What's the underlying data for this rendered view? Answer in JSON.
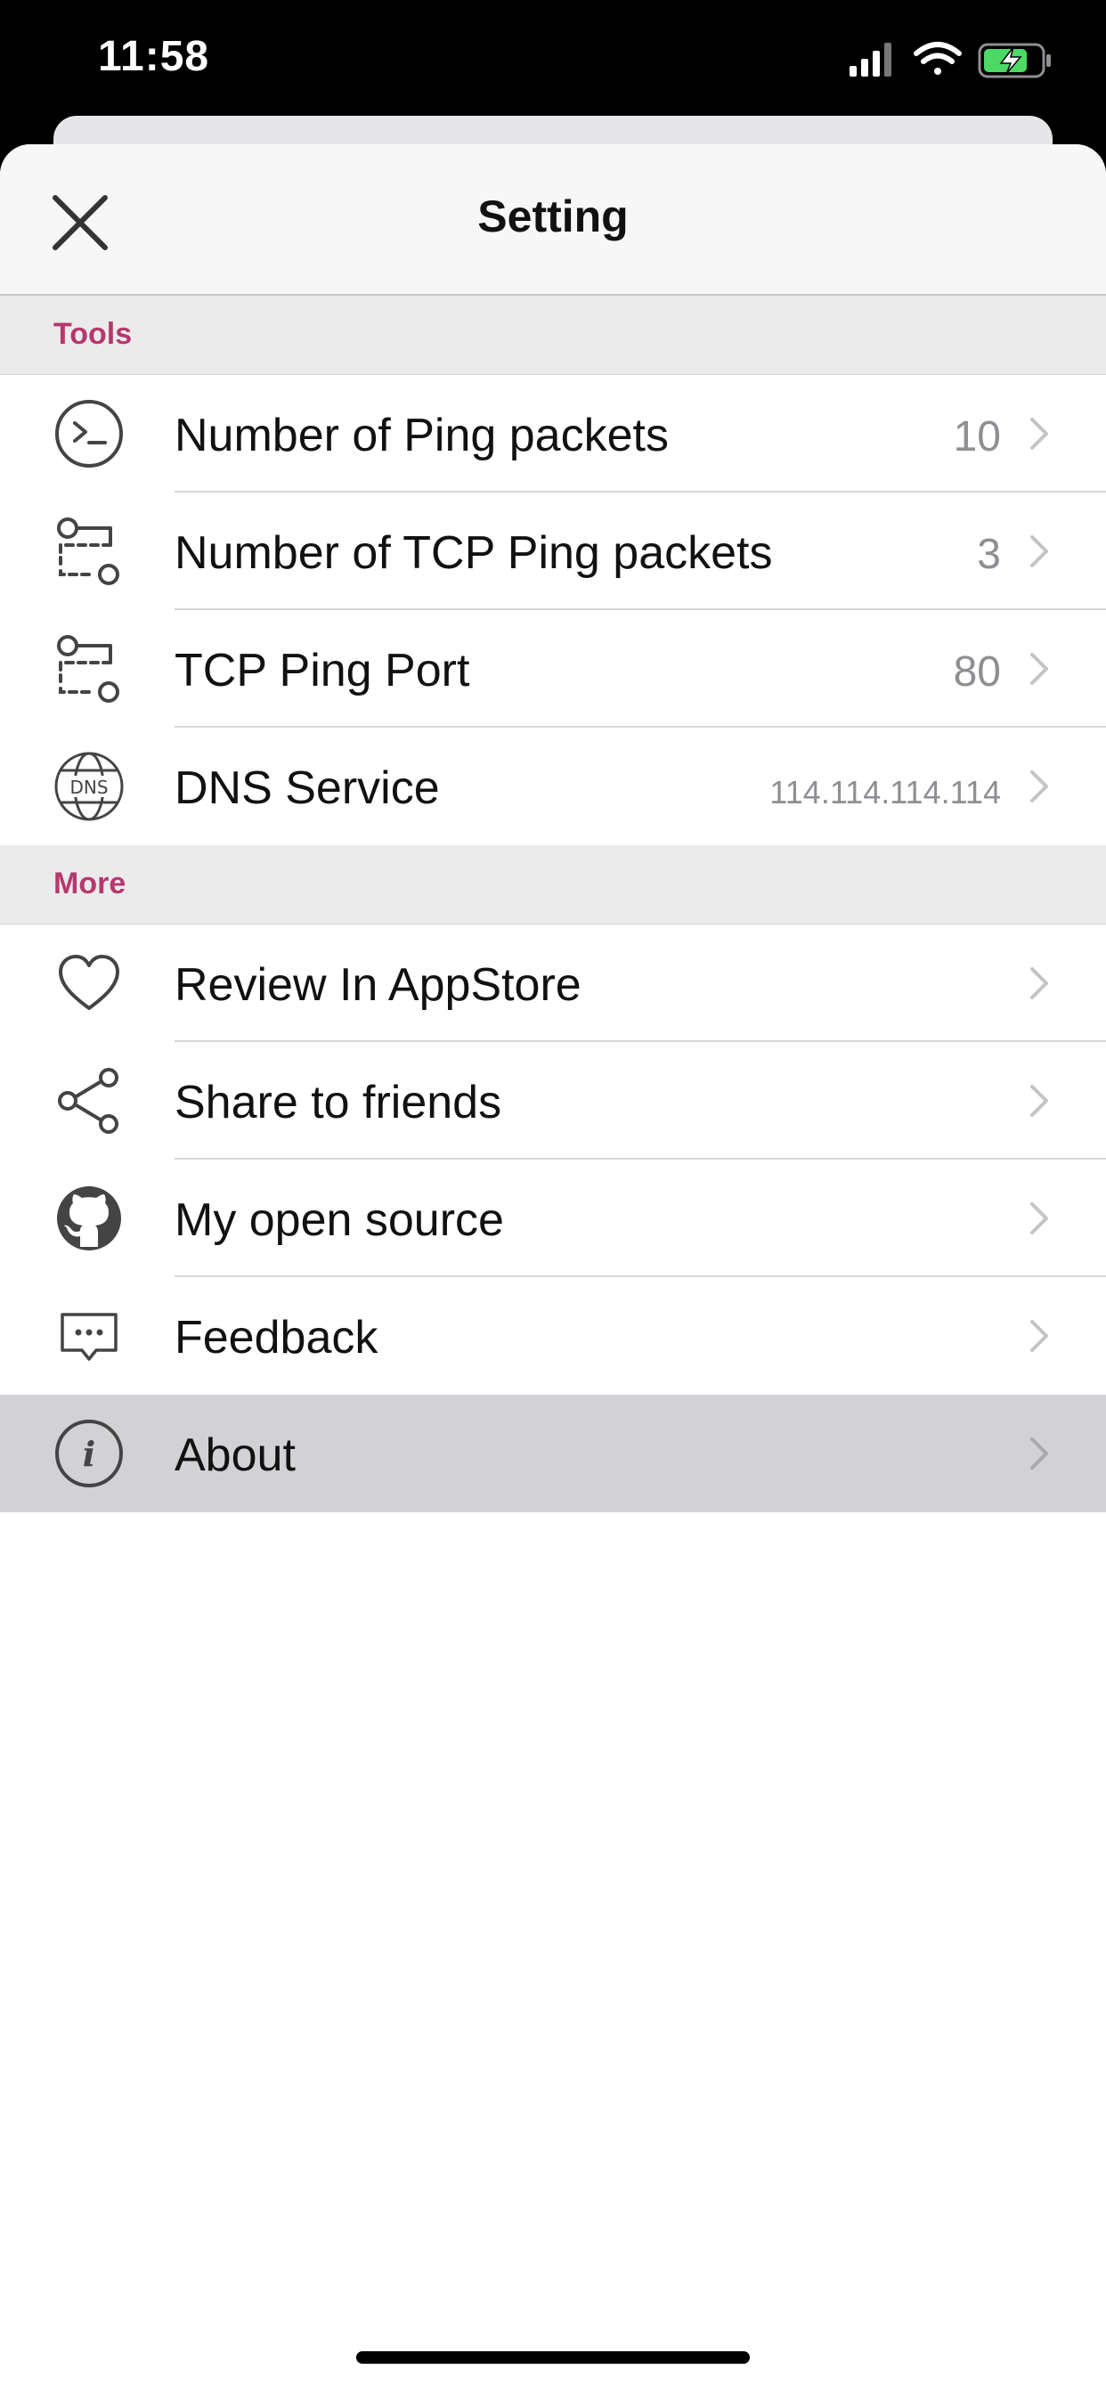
{
  "status_bar": {
    "time": "11:58"
  },
  "nav": {
    "title": "Setting"
  },
  "sections": [
    {
      "title": "Tools",
      "rows": [
        {
          "label": "Number of Ping packets",
          "value": "10",
          "icon": "terminal-icon"
        },
        {
          "label": "Number of TCP Ping packets",
          "value": "3",
          "icon": "tcp-flow-icon"
        },
        {
          "label": "TCP Ping Port",
          "value": "80",
          "icon": "tcp-flow-icon"
        },
        {
          "label": "DNS Service",
          "value": "114.114.114.114",
          "icon": "dns-globe-icon"
        }
      ]
    },
    {
      "title": "More",
      "rows": [
        {
          "label": "Review In AppStore",
          "icon": "heart-icon"
        },
        {
          "label": "Share to friends",
          "icon": "share-icon"
        },
        {
          "label": "My open source",
          "icon": "github-icon"
        },
        {
          "label": "Feedback",
          "icon": "chat-bubble-icon"
        },
        {
          "label": "About",
          "icon": "info-icon",
          "selected": true
        }
      ]
    }
  ],
  "colors": {
    "section_title": "#b5386e",
    "selected_row": "#d1d1d6",
    "value_text": "#8e8e93"
  }
}
